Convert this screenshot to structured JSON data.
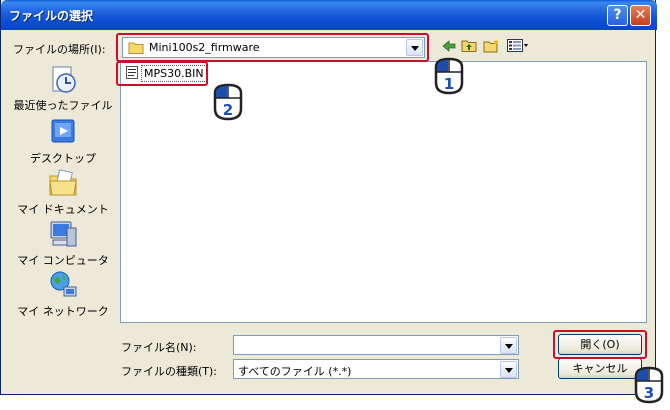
{
  "window": {
    "title": "ファイルの選択",
    "help_button": "?",
    "close_button": "✕"
  },
  "look_in": {
    "label": "ファイルの場所(I):",
    "value": "Mini100s2_firmware"
  },
  "places": [
    {
      "label": "最近使ったファイル",
      "icon": "recent-files-icon"
    },
    {
      "label": "デスクトップ",
      "icon": "desktop-icon"
    },
    {
      "label": "マイ ドキュメント",
      "icon": "my-documents-icon"
    },
    {
      "label": "マイ コンピュータ",
      "icon": "my-computer-icon"
    },
    {
      "label": "マイ ネットワーク",
      "icon": "my-network-icon"
    }
  ],
  "files": [
    {
      "name": "MPS30.BIN"
    }
  ],
  "filename": {
    "label": "ファイル名(N):",
    "value": ""
  },
  "filetype": {
    "label": "ファイルの種類(T):",
    "value": "すべてのファイル (*.*)"
  },
  "buttons": {
    "open": "開く(O)",
    "cancel": "キャンセル"
  },
  "steps": [
    "1",
    "2",
    "3"
  ],
  "colors": {
    "highlight": "#c8102e",
    "step_blue": "#1a4fb0"
  }
}
